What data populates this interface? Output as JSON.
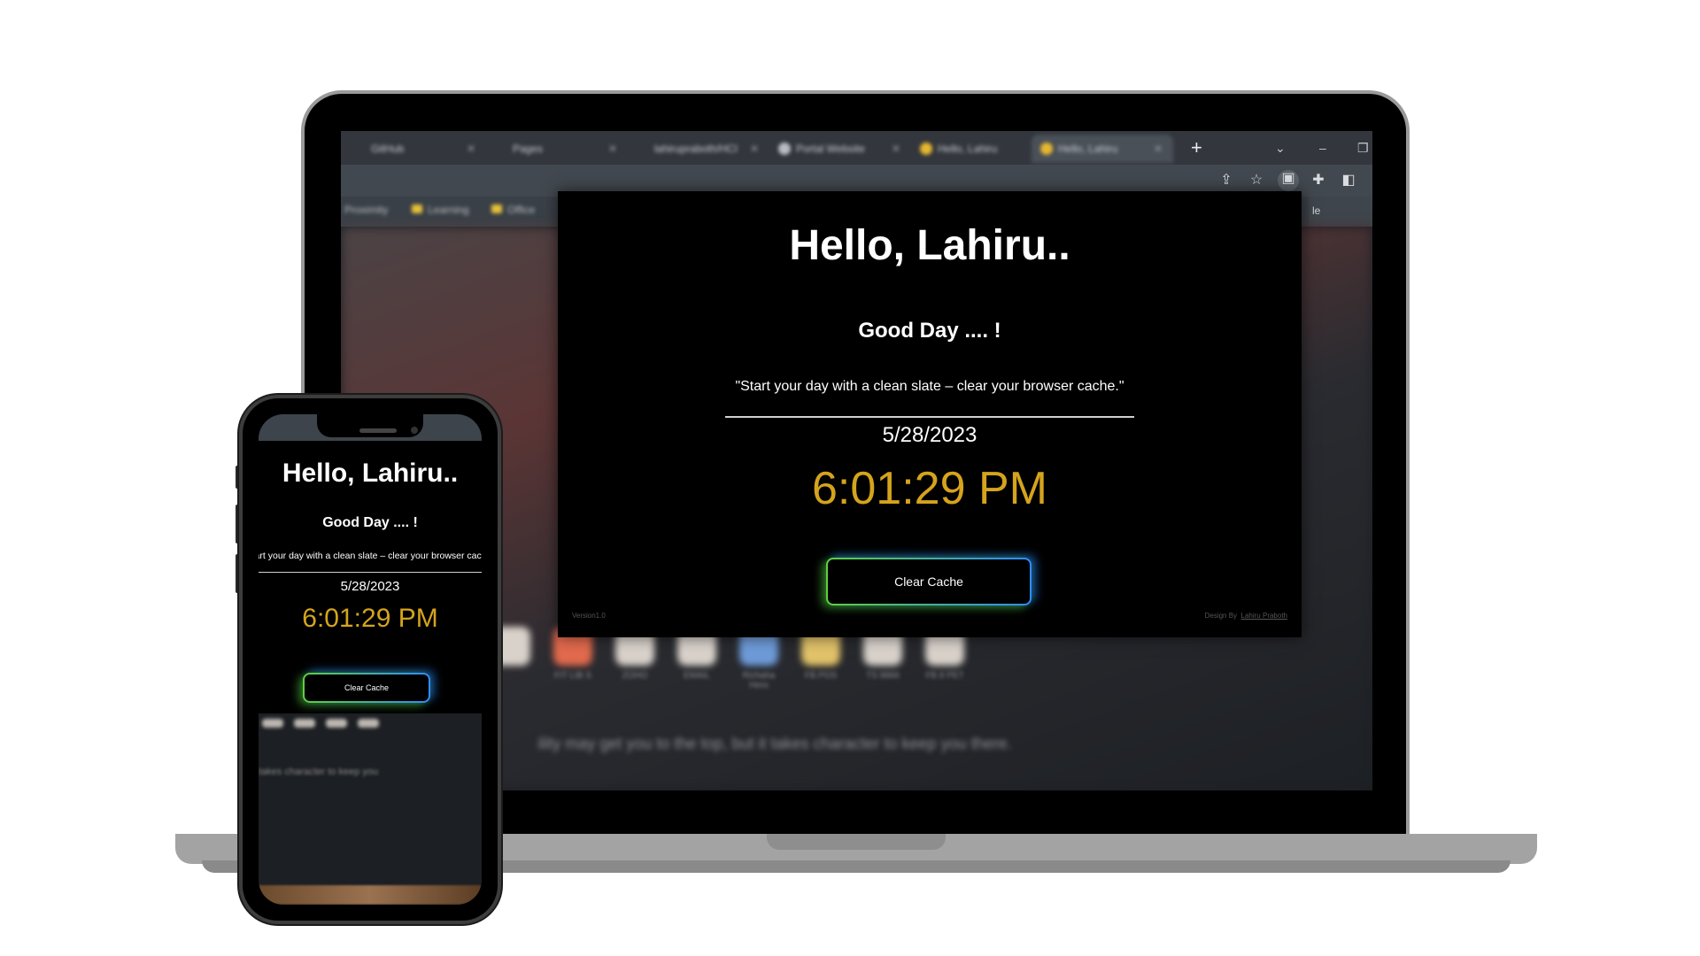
{
  "browser": {
    "tabs": [
      {
        "label": "GitHub",
        "active": false
      },
      {
        "label": "Pages",
        "active": false
      },
      {
        "label": "lahirupraboth/HCI",
        "active": false
      },
      {
        "label": "Portal Website",
        "active": false
      },
      {
        "label": "Hello, Lahiru",
        "active": false
      },
      {
        "label": "Hello, Lahiru",
        "active": true
      }
    ],
    "new_tab_symbol": "+",
    "window_controls": {
      "dropdown": "⌄",
      "minimize": "–",
      "restore": "❐"
    },
    "toolbar_icons": [
      "share-icon",
      "star-icon",
      "extension-app-icon",
      "puzzle-icon",
      "side-panel-icon"
    ],
    "bookmarks": [
      "Proximity",
      "Learning",
      "Office"
    ],
    "side_peek_text": "le",
    "blurred_quote": "ility may get you to the top, but it takes character to keep you there.",
    "tile_labels": [
      "",
      "FIT LIB S",
      "ZOHO",
      "EMAIL",
      "Richaha Hero",
      "FB.POS",
      "TS 8866",
      "FB 8 PET"
    ]
  },
  "popup": {
    "greeting": "Hello, Lahiru..",
    "subtitle": "Good Day .... !",
    "quote": "\"Start your day with a clean slate – clear your browser cache.\"",
    "date": "5/28/2023",
    "time": "6:01:29 PM",
    "button_label": "Clear Cache",
    "version": "Version1.0",
    "design_by_label": "Design By",
    "designer": "Lahiru Praboth"
  },
  "phone": {
    "greeting": "Hello, Lahiru..",
    "subtitle": "Good Day .... !",
    "quote": "\"Start your day with a clean slate – clear your browser cache.\"",
    "date": "5/28/2023",
    "time": "6:01:29 PM",
    "button_label": "Clear Cache",
    "blurred_text": "takes character to keep you"
  },
  "colors": {
    "time_accent": "#d5a41c",
    "button_glow_green": "#5fd13c",
    "button_glow_blue": "#2f8bff",
    "popup_bg": "#000000"
  }
}
